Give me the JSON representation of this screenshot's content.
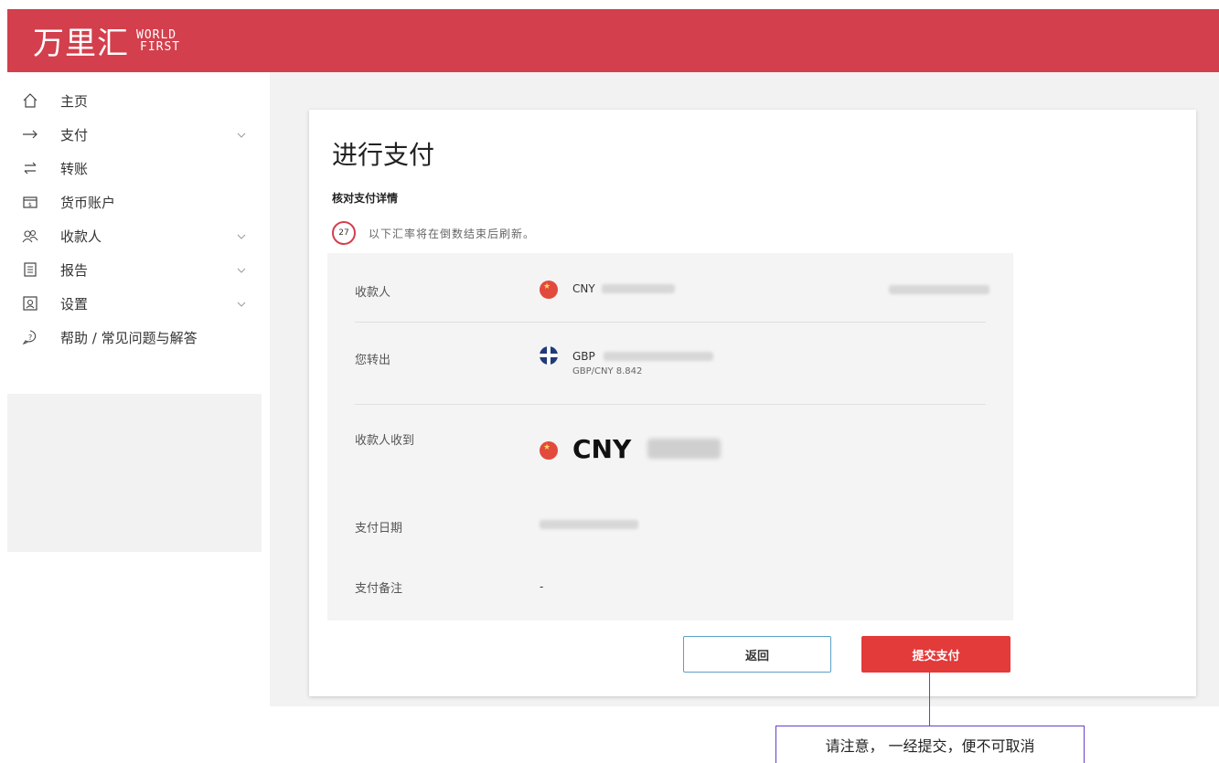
{
  "brand": {
    "cn": "万里汇",
    "en_line1": "WORLD",
    "en_line2": "FIRST",
    "color": "#d33f4c"
  },
  "sidebar": {
    "items": [
      {
        "label": "主页",
        "icon": "home-icon",
        "has_chevron": false
      },
      {
        "label": "支付",
        "icon": "arrow-right-icon",
        "has_chevron": true
      },
      {
        "label": "转账",
        "icon": "transfer-icon",
        "has_chevron": false
      },
      {
        "label": "货币账户",
        "icon": "wallet-icon",
        "has_chevron": false
      },
      {
        "label": "收款人",
        "icon": "people-icon",
        "has_chevron": true
      },
      {
        "label": "报告",
        "icon": "report-icon",
        "has_chevron": true
      },
      {
        "label": "设置",
        "icon": "settings-icon",
        "has_chevron": true
      },
      {
        "label": "帮助 / 常见问题与解答",
        "icon": "help-icon",
        "has_chevron": false
      }
    ]
  },
  "page": {
    "title": "进行支付",
    "section_title": "核对支付详情",
    "timer_value": "27",
    "timer_text": "以下汇率将在倒数结束后刷新。"
  },
  "details": {
    "payee": {
      "label": "收款人",
      "currency": "CNY"
    },
    "you_send": {
      "label": "您转出",
      "currency": "GBP",
      "rate": "GBP/CNY 8.842"
    },
    "payee_receives": {
      "label": "收款人收到",
      "currency": "CNY"
    },
    "payment_date": {
      "label": "支付日期"
    },
    "payment_note": {
      "label": "支付备注",
      "value": "-"
    }
  },
  "buttons": {
    "back": "返回",
    "submit": "提交支付"
  },
  "callout": {
    "text": "请注意， 一经提交，便不可取消"
  },
  "colors": {
    "accent": "#d33f4c",
    "submit": "#e33a3a",
    "callout_border": "#6b3ec6"
  }
}
